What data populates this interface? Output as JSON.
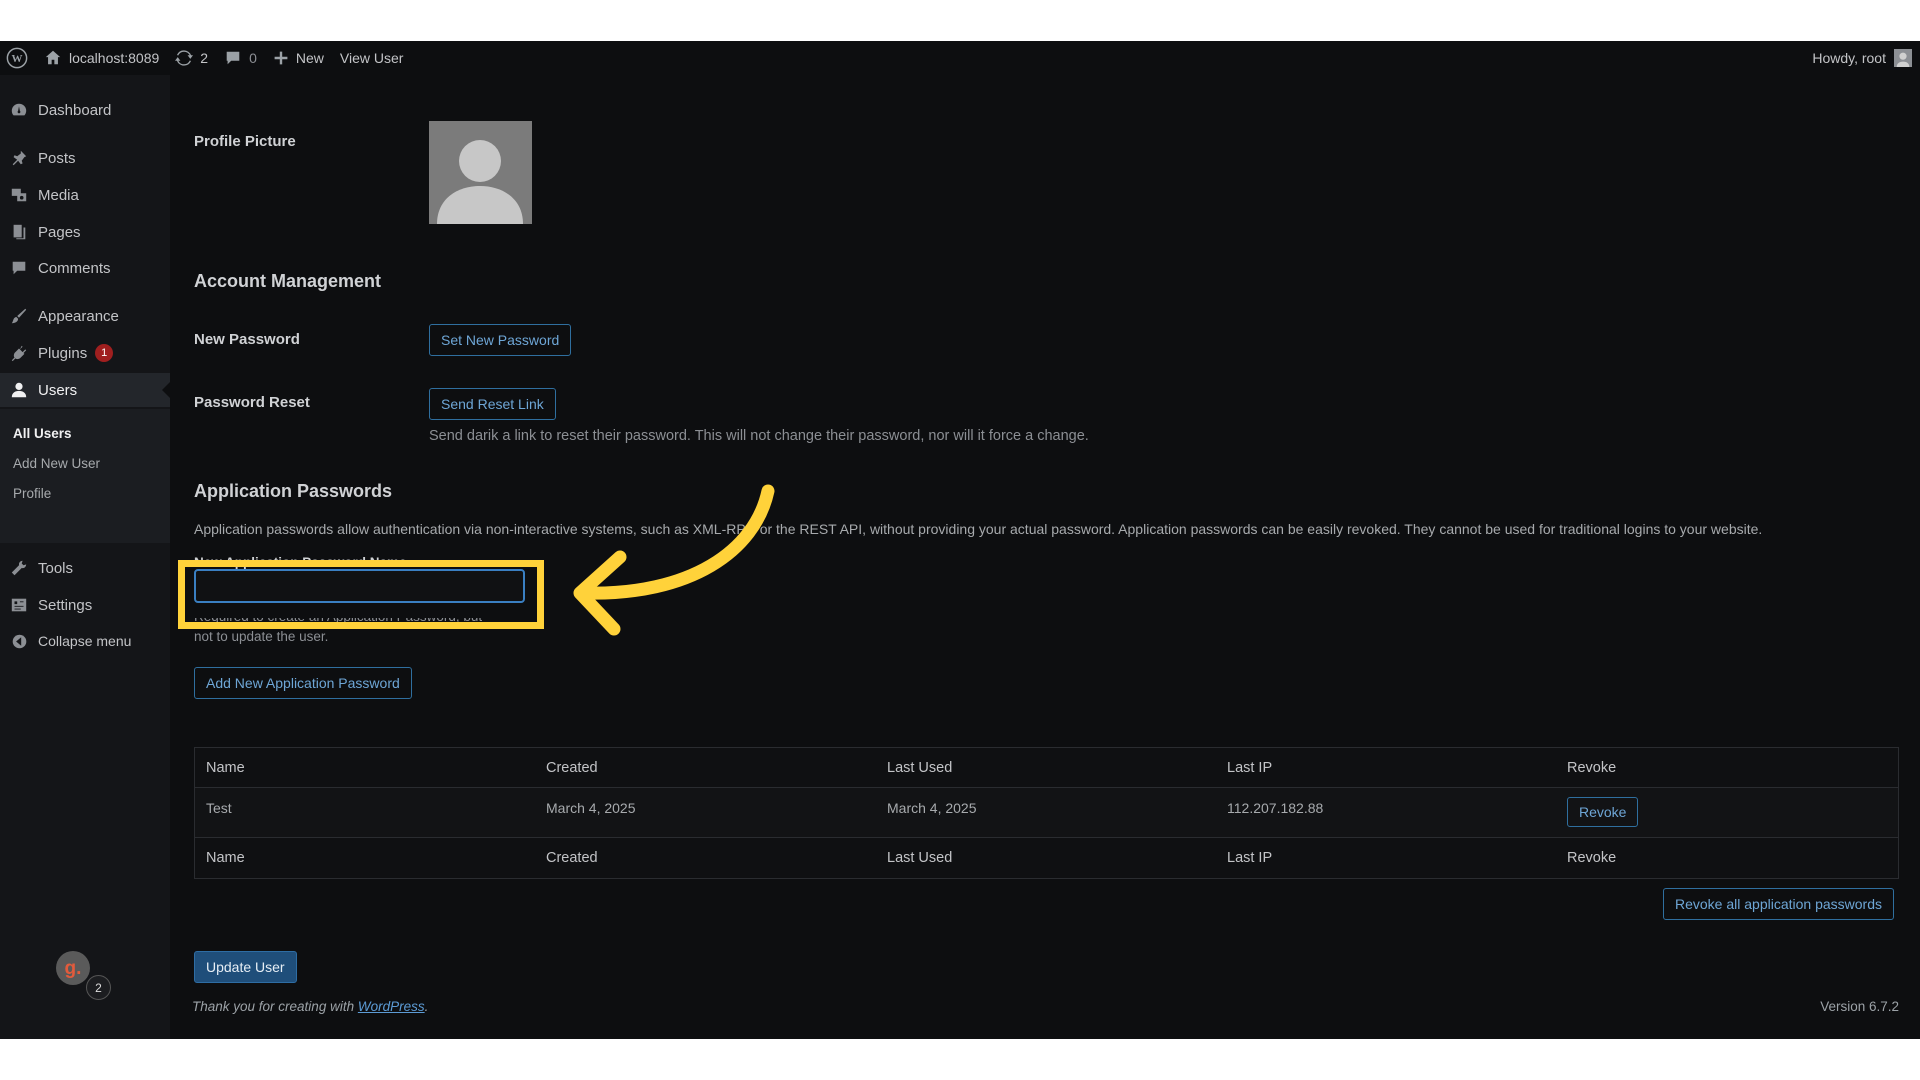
{
  "colors": {
    "background": "#0d0e10",
    "sidebar": "#141518",
    "accent_link": "#6ea6d6",
    "primary_button": "#1f4e7a",
    "highlight": "#ffd23a",
    "badge": "#a01f1f"
  },
  "adminbar": {
    "site": "localhost:8089",
    "updates_count": "2",
    "comments_count": "0",
    "new_label": "New",
    "view_user_label": "View User",
    "greeting": "Howdy, root"
  },
  "sidebar": {
    "items": [
      {
        "label": "Dashboard",
        "icon": "dashboard-icon"
      },
      {
        "label": "Posts",
        "icon": "pin-icon"
      },
      {
        "label": "Media",
        "icon": "media-icon"
      },
      {
        "label": "Pages",
        "icon": "pages-icon"
      },
      {
        "label": "Comments",
        "icon": "comment-icon"
      },
      {
        "label": "Appearance",
        "icon": "brush-icon"
      },
      {
        "label": "Plugins",
        "icon": "plugin-icon",
        "badge": "1"
      },
      {
        "label": "Users",
        "icon": "user-icon"
      },
      {
        "label": "Tools",
        "icon": "wrench-icon"
      },
      {
        "label": "Settings",
        "icon": "settings-icon"
      },
      {
        "label": "Collapse menu",
        "icon": "collapse-icon"
      }
    ],
    "submenu": [
      "All Users",
      "Add New User",
      "Profile"
    ],
    "floating_badge": "2"
  },
  "profile": {
    "picture_label": "Profile Picture"
  },
  "account": {
    "heading": "Account Management",
    "new_password_label": "New Password",
    "set_new_password_button": "Set New Password",
    "password_reset_label": "Password Reset",
    "send_reset_link_button": "Send Reset Link",
    "reset_description": "Send darik a link to reset their password. This will not change their password, nor will it force a change."
  },
  "app_passwords": {
    "heading": "Application Passwords",
    "description": "Application passwords allow authentication via non-interactive systems, such as XML-RPC or the REST API, without providing your actual password. Application passwords can be easily revoked. They cannot be used for traditional logins to your website.",
    "input_label": "New Application Password Name",
    "input_value": "",
    "help_text_line1": "Required to create an Application Password, but",
    "help_text_line2": "not to update the user.",
    "add_button": "Add New Application Password",
    "table": {
      "headers": [
        "Name",
        "Created",
        "Last Used",
        "Last IP",
        "Revoke"
      ],
      "rows": [
        {
          "name": "Test",
          "created": "March 4, 2025",
          "last_used": "March 4, 2025",
          "last_ip": "112.207.182.88",
          "revoke": "Revoke"
        }
      ]
    },
    "revoke_all_button": "Revoke all application passwords"
  },
  "update_button": "Update User",
  "footer": {
    "text": "Thank you for creating with",
    "link": "WordPress",
    "period": ".",
    "version": "Version 6.7.2"
  }
}
